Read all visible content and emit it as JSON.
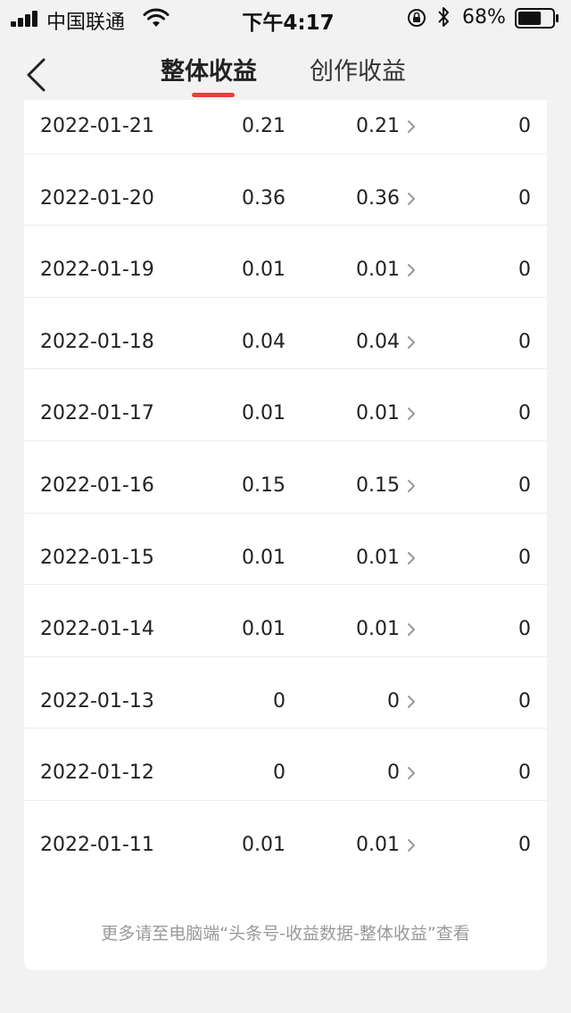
{
  "status_bar": {
    "carrier": "中国联通",
    "time": "下午4:17",
    "battery_percent": "68%",
    "battery_level": 0.68
  },
  "header": {
    "tabs": [
      {
        "label": "整体收益",
        "active": true
      },
      {
        "label": "创作收益",
        "active": false
      }
    ],
    "accent_color": "#e8403a"
  },
  "rows": [
    {
      "date": "2022-01-21",
      "value1": "0.21",
      "value2": "0.21",
      "value3": "0"
    },
    {
      "date": "2022-01-20",
      "value1": "0.36",
      "value2": "0.36",
      "value3": "0"
    },
    {
      "date": "2022-01-19",
      "value1": "0.01",
      "value2": "0.01",
      "value3": "0"
    },
    {
      "date": "2022-01-18",
      "value1": "0.04",
      "value2": "0.04",
      "value3": "0"
    },
    {
      "date": "2022-01-17",
      "value1": "0.01",
      "value2": "0.01",
      "value3": "0"
    },
    {
      "date": "2022-01-16",
      "value1": "0.15",
      "value2": "0.15",
      "value3": "0"
    },
    {
      "date": "2022-01-15",
      "value1": "0.01",
      "value2": "0.01",
      "value3": "0"
    },
    {
      "date": "2022-01-14",
      "value1": "0.01",
      "value2": "0.01",
      "value3": "0"
    },
    {
      "date": "2022-01-13",
      "value1": "0",
      "value2": "0",
      "value3": "0"
    },
    {
      "date": "2022-01-12",
      "value1": "0",
      "value2": "0",
      "value3": "0"
    },
    {
      "date": "2022-01-11",
      "value1": "0.01",
      "value2": "0.01",
      "value3": "0"
    }
  ],
  "footer": {
    "note": "更多请至电脑端“头条号-收益数据-整体收益”查看"
  }
}
